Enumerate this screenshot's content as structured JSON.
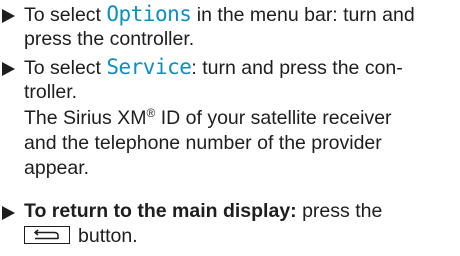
{
  "steps": [
    {
      "lines": [
        {
          "pre": "To select ",
          "term": "Options",
          "post": " in the menu bar: turn and"
        },
        {
          "text": "press the controller."
        }
      ]
    },
    {
      "lines": [
        {
          "pre": "To select ",
          "term": "Service",
          "post": ": turn and press the con-"
        },
        {
          "text": "troller."
        },
        {
          "pre": "The Sirius XM",
          "sup": "®",
          "post": " ID of your satellite receiver"
        },
        {
          "text": "and the telephone number of the provider"
        },
        {
          "text": "appear."
        }
      ]
    },
    {
      "lines": [
        {
          "bold": "To return to the main display:",
          "post": " press the"
        },
        {
          "post": "button.",
          "icon": "back-arrow-icon"
        }
      ]
    }
  ],
  "colors": {
    "text": "#1e1e1e",
    "menu_term": "#0a8fc6"
  }
}
